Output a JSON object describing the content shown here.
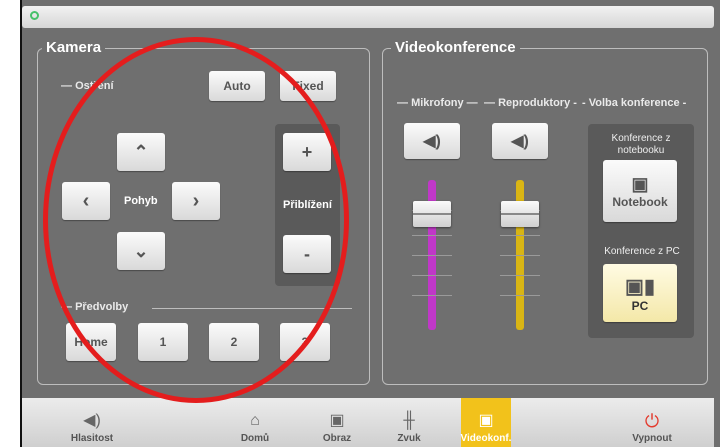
{
  "kamera": {
    "title": "Kamera",
    "focus_label": "Ostření",
    "auto_label": "Auto",
    "fixed_label": "Fixed",
    "up_icon": "⌃",
    "down_icon": "⌄",
    "left_icon": "‹",
    "right_icon": "›",
    "pohyb_label": "Pohyb",
    "zoom_in": "+",
    "zoom_out": "-",
    "zoom_label": "Přiblížení",
    "presets_label": "Předvolby",
    "presets": [
      "Home",
      "1",
      "2",
      "3"
    ]
  },
  "video": {
    "title": "Videokonference",
    "mic_label": "Mikrofony",
    "spk_label": "Reproduktory",
    "conf_label": "Volba konference",
    "notebook_caption": "Konference z notebooku",
    "notebook_btn": "Notebook",
    "pc_caption": "Konference z PC",
    "pc_btn": "PC",
    "mic_level": 0.62,
    "spk_level": 0.62
  },
  "nav": {
    "items": [
      {
        "label": "Hlasitost",
        "icon": "speaker-icon"
      },
      {
        "label": "Domů",
        "icon": "home-icon"
      },
      {
        "label": "Obraz",
        "icon": "monitor-icon"
      },
      {
        "label": "Zvuk",
        "icon": "mixer-icon"
      },
      {
        "label": "Videokonf.",
        "icon": "videoconf-icon",
        "active": true
      },
      {
        "label": "Vypnout",
        "icon": "power-icon"
      }
    ]
  },
  "colors": {
    "mic_track": "#c038c8",
    "spk_track": "#d9b514",
    "active": "#f2c21b",
    "power": "#e33b2e",
    "annotation": "#e41d1d"
  }
}
